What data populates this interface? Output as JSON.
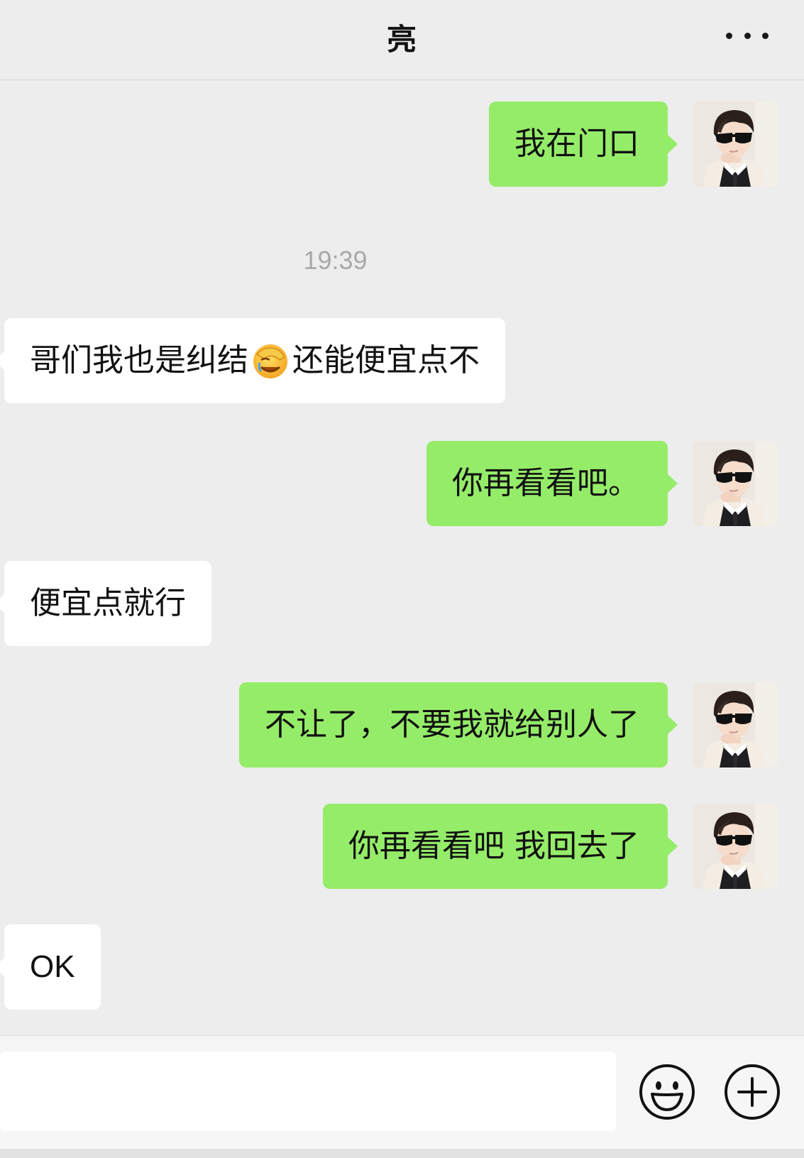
{
  "header": {
    "title": "亮"
  },
  "colors": {
    "background": "#ededed",
    "outgoing_bubble": "#95ec69",
    "incoming_bubble": "#ffffff",
    "timestamp_text": "#a8a8a8"
  },
  "messages": [
    {
      "direction": "outgoing",
      "text": "我在门口"
    },
    {
      "type": "timestamp",
      "text": "19:39"
    },
    {
      "direction": "incoming",
      "text_before_emoji": "哥们我也是纠结",
      "emoji": "face-palm-emoji",
      "text_after_emoji": "还能便宜点不"
    },
    {
      "direction": "outgoing",
      "text": "你再看看吧。"
    },
    {
      "direction": "incoming",
      "text": "便宜点就行"
    },
    {
      "direction": "outgoing",
      "text": "不让了，不要我就给别人了"
    },
    {
      "direction": "outgoing",
      "text": "你再看看吧 我回去了"
    },
    {
      "direction": "incoming",
      "text": "OK"
    }
  ],
  "icons": {
    "more": "more-dots-icon",
    "emoji_button": "emoji-smiley-icon",
    "plus_button": "plus-icon",
    "avatar": "avatar-boy-sunglasses"
  },
  "input": {
    "value": "",
    "placeholder": ""
  }
}
